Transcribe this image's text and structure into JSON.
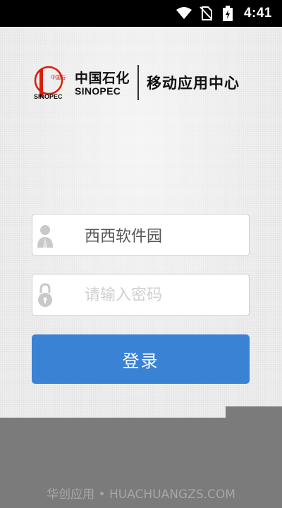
{
  "status_bar": {
    "time": "4:41",
    "icons": [
      "wifi-icon",
      "no-sim-icon",
      "battery-charging-icon"
    ]
  },
  "brand": {
    "emblem_text": "中国石化",
    "emblem_caption": "SINOPEC",
    "company_cn": "中国石化",
    "company_en": "SINOPEC",
    "app_title": "移动应用中心",
    "colors": {
      "emblem_red": "#d81e06",
      "text": "#111111"
    }
  },
  "login_form": {
    "username": {
      "icon": "user-icon",
      "value": "西西软件园"
    },
    "password": {
      "icon": "lock-icon",
      "placeholder": "请输入密码"
    },
    "submit_label": "登录",
    "accent_color": "#3a82d4"
  },
  "watermark": {
    "text": "华创应用 • HUACHUANGZS.COM"
  }
}
